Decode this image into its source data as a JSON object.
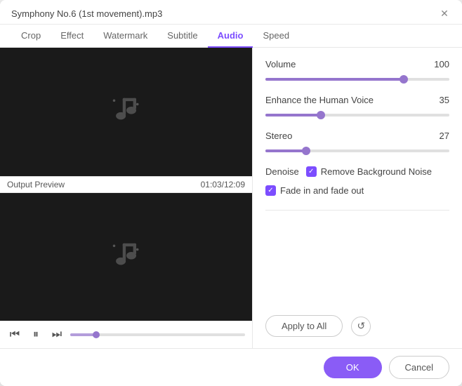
{
  "titleBar": {
    "title": "Symphony No.6 (1st movement).mp3",
    "closeLabel": "✕"
  },
  "tabs": [
    {
      "id": "crop",
      "label": "Crop",
      "active": false
    },
    {
      "id": "effect",
      "label": "Effect",
      "active": false
    },
    {
      "id": "watermark",
      "label": "Watermark",
      "active": false
    },
    {
      "id": "subtitle",
      "label": "Subtitle",
      "active": false
    },
    {
      "id": "audio",
      "label": "Audio",
      "active": true
    },
    {
      "id": "speed",
      "label": "Speed",
      "active": false
    }
  ],
  "leftPanel": {
    "outputLabel": "Output Preview",
    "timestamp": "01:03/12:09"
  },
  "rightPanel": {
    "volume": {
      "label": "Volume",
      "value": 100,
      "fillPercent": 75
    },
    "enhanceHumanVoice": {
      "label": "Enhance the Human Voice",
      "value": 35,
      "fillPercent": 30
    },
    "stereo": {
      "label": "Stereo",
      "value": 27,
      "fillPercent": 22
    },
    "denoise": {
      "label": "Denoise",
      "removeNoise": {
        "label": "Remove Background Noise",
        "checked": true
      }
    },
    "fadeInOut": {
      "label": "Fade in and fade out",
      "checked": true
    },
    "applyBtn": "Apply to All",
    "resetIcon": "↺"
  },
  "bottomBar": {
    "okLabel": "OK",
    "cancelLabel": "Cancel"
  }
}
